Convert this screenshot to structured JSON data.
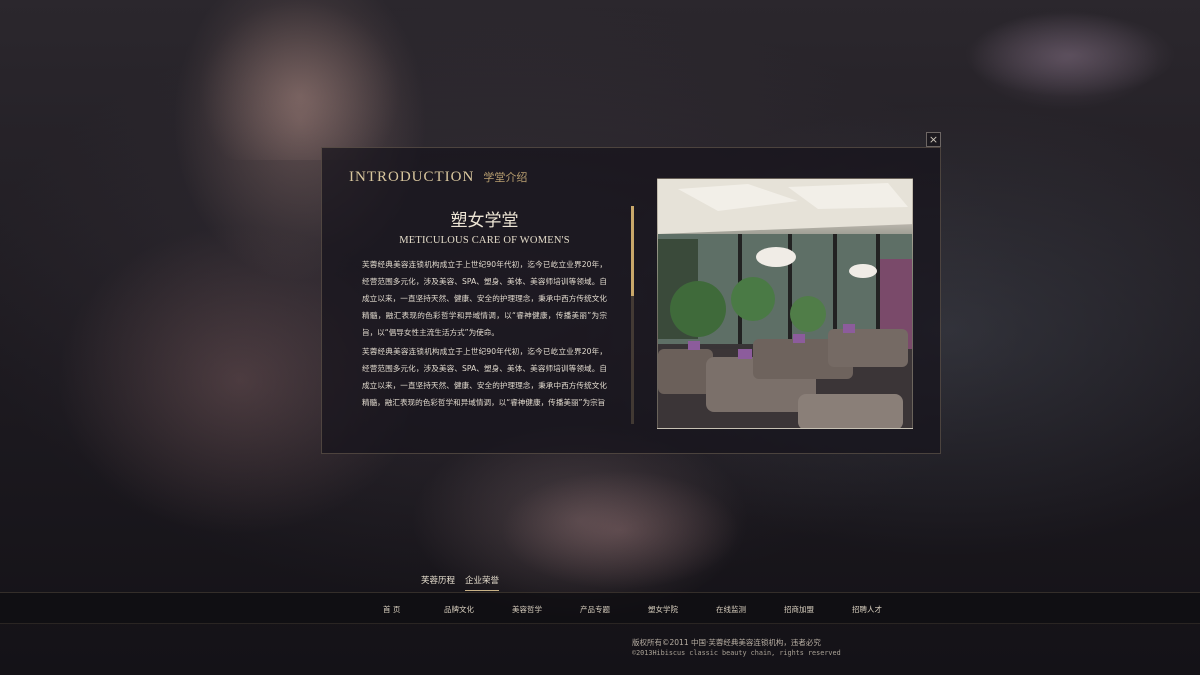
{
  "modal": {
    "close_label": "×",
    "heading_en": "INTRODUCTION",
    "heading_cn": "学堂介绍",
    "title_cn": "塑女学堂",
    "title_en": "METICULOUS CARE OF WOMEN'S",
    "paragraphs": [
      "芙蓉经典美容连锁机构成立于上世纪90年代初，迄今已屹立业界20年，经营范围多元化，涉及美容、SPA、塑身、美体、美容师培训等领域。自成立以来，一直坚持天然、健康、安全的护理理念，秉承中西方传统文化精髓，融汇表现的色彩哲学和异域情调，以“睿神健康，传播美丽”为宗旨，以“倡导女性主流生活方式”为使命。",
      "芙蓉经典美容连锁机构成立于上世纪90年代初，迄今已屹立业界20年，经营范围多元化，涉及美容、SPA、塑身、美体、美容师培训等领域。自成立以来，一直坚持天然、健康、安全的护理理念，秉承中西方传统文化精髓，融汇表现的色彩哲学和异域情调，以“睿神健康，传播美丽”为宗旨"
    ],
    "photo_icon": "lounge-photo"
  },
  "subtabs": [
    "芙蓉历程",
    "企业荣誉"
  ],
  "nav": [
    "首 页",
    "品牌文化",
    "美容哲学",
    "产品专题",
    "塑女学院",
    "在线监测",
    "招商加盟",
    "招聘人才"
  ],
  "footer": {
    "line1": "版权所有©2011 中国·芙蓉经典美容连锁机构，违者必究",
    "line2": "©2013Hibiscus classic beauty chain, rights reserved"
  }
}
